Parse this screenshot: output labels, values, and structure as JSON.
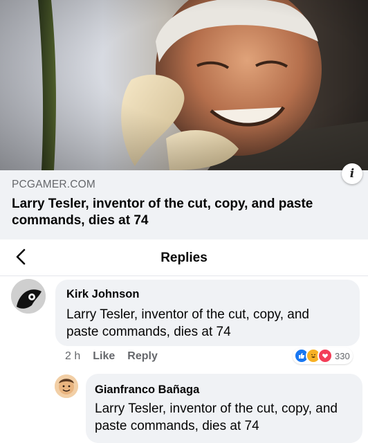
{
  "link_preview": {
    "source": "PCGAMER.COM",
    "title": "Larry Tesler, inventor of the cut, copy, and paste commands, dies at 74"
  },
  "header": {
    "title": "Replies"
  },
  "comments": [
    {
      "author": "Kirk Johnson",
      "text": "Larry Tesler, inventor of the cut, copy, and paste commands, dies at 74",
      "time": "2 h",
      "like_label": "Like",
      "reply_label": "Reply",
      "reaction_count": "330",
      "reactions": [
        "like-icon",
        "haha-icon",
        "love-icon"
      ]
    },
    {
      "author": "Gianfranco Bañaga",
      "text": "Larry Tesler, inventor of the cut, copy, and paste commands, dies at 74"
    }
  ],
  "colors": {
    "background": "#ffffff",
    "bubble": "#f0f2f5",
    "meta_text": "#65676b",
    "like_blue": "#1877f2",
    "love_red": "#f33e58",
    "haha_yellow": "#f7b125"
  }
}
